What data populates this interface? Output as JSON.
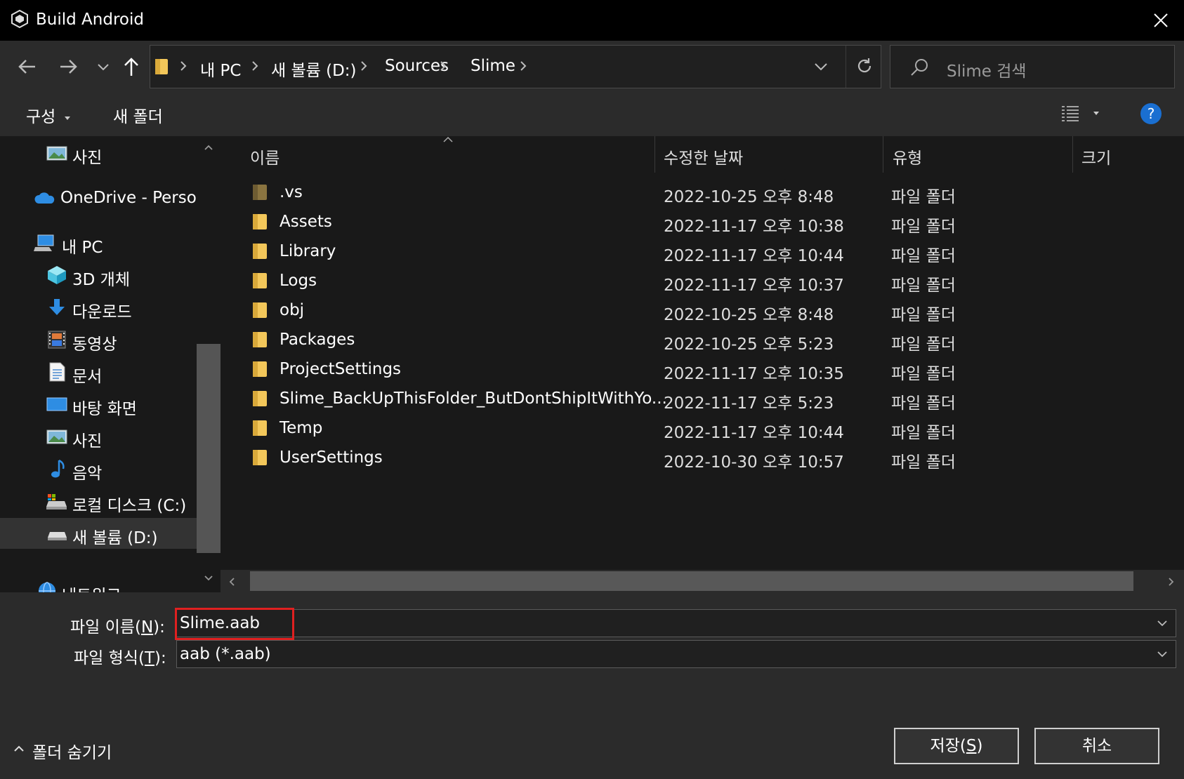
{
  "window": {
    "title": "Build Android",
    "icon": "unity-icon"
  },
  "nav": {
    "breadcrumbs": [
      "내 PC",
      "새 볼륨 (D:)",
      "Sources",
      "Slime"
    ],
    "search_placeholder": "Slime 검색"
  },
  "toolbar": {
    "organize": "구성",
    "new_folder": "새 폴더"
  },
  "sidebar": {
    "items": [
      {
        "label": "사진",
        "icon": "pictures-icon"
      },
      {
        "label": "OneDrive - Persor",
        "icon": "onedrive-icon"
      },
      {
        "label": "내 PC",
        "icon": "this-pc-icon"
      },
      {
        "label": "3D 개체",
        "icon": "3d-objects-icon"
      },
      {
        "label": "다운로드",
        "icon": "downloads-icon"
      },
      {
        "label": "동영상",
        "icon": "videos-icon"
      },
      {
        "label": "문서",
        "icon": "documents-icon"
      },
      {
        "label": "바탕 화면",
        "icon": "desktop-icon"
      },
      {
        "label": "사진",
        "icon": "pictures-icon"
      },
      {
        "label": "음악",
        "icon": "music-icon"
      },
      {
        "label": "로컬 디스크 (C:)",
        "icon": "local-disk-icon"
      },
      {
        "label": "새 볼륨 (D:)",
        "icon": "drive-icon"
      },
      {
        "label": "네트워크",
        "icon": "network-icon"
      }
    ]
  },
  "columns": {
    "name": "이름",
    "date": "수정한 날짜",
    "type": "유형",
    "size": "크기"
  },
  "files": [
    {
      "name": ".vs",
      "date": "2022-10-25 오후 8:48",
      "type": "파일 폴더"
    },
    {
      "name": "Assets",
      "date": "2022-11-17 오후 10:38",
      "type": "파일 폴더"
    },
    {
      "name": "Library",
      "date": "2022-11-17 오후 10:44",
      "type": "파일 폴더"
    },
    {
      "name": "Logs",
      "date": "2022-11-17 오후 10:37",
      "type": "파일 폴더"
    },
    {
      "name": "obj",
      "date": "2022-10-25 오후 8:48",
      "type": "파일 폴더"
    },
    {
      "name": "Packages",
      "date": "2022-10-25 오후 5:23",
      "type": "파일 폴더"
    },
    {
      "name": "ProjectSettings",
      "date": "2022-11-17 오후 10:35",
      "type": "파일 폴더"
    },
    {
      "name": "Slime_BackUpThisFolder_ButDontShipItWithYo...",
      "date": "2022-11-17 오후 5:23",
      "type": "파일 폴더"
    },
    {
      "name": "Temp",
      "date": "2022-11-17 오후 10:44",
      "type": "파일 폴더"
    },
    {
      "name": "UserSettings",
      "date": "2022-10-30 오후 10:57",
      "type": "파일 폴더"
    }
  ],
  "form": {
    "filename_label_pre": "파일 이름(",
    "filename_label_key": "N",
    "filename_label_post": "):",
    "filename_value": "Slime.aab",
    "filetype_label_pre": "파일 형식(",
    "filetype_label_key": "T",
    "filetype_label_post": "):",
    "filetype_value": "aab (*.aab)"
  },
  "buttons": {
    "save_pre": "저장(",
    "save_key": "S",
    "save_post": ")",
    "cancel": "취소",
    "hide_folders": "폴더 숨기기"
  },
  "colors": {
    "highlight": "#e02020",
    "folder": "#f3c75a",
    "help": "#1a6fd1"
  }
}
